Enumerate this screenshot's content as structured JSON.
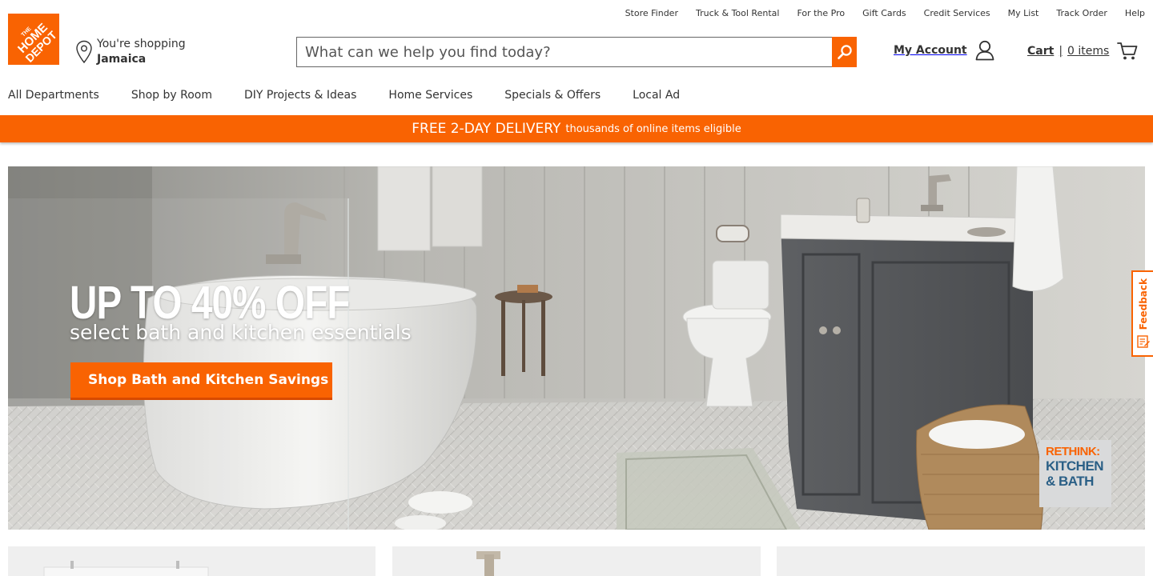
{
  "utility_nav": [
    {
      "label": "Store Finder"
    },
    {
      "label": "Truck & Tool Rental"
    },
    {
      "label": "For the Pro"
    },
    {
      "label": "Gift Cards"
    },
    {
      "label": "Credit Services"
    },
    {
      "label": "My List"
    },
    {
      "label": "Track Order"
    },
    {
      "label": "Help"
    }
  ],
  "brand": {
    "logo_text": "THE HOME DEPOT",
    "color": "#f96302"
  },
  "store": {
    "prefix": "You're shopping",
    "name": "Jamaica",
    "icon": "location-pin-icon"
  },
  "search": {
    "placeholder": "What can we help you find today?",
    "value": "",
    "icon": "search-icon"
  },
  "account": {
    "label": "My Account",
    "icon": "user-icon"
  },
  "cart": {
    "label": "Cart",
    "separator": "|",
    "count_text": "0 items",
    "icon": "cart-icon"
  },
  "main_nav": [
    {
      "label": "All Departments"
    },
    {
      "label": "Shop by Room"
    },
    {
      "label": "DIY Projects & Ideas"
    },
    {
      "label": "Home Services"
    },
    {
      "label": "Specials & Offers"
    },
    {
      "label": "Local Ad"
    }
  ],
  "promo": {
    "headline": "FREE 2-DAY DELIVERY",
    "detail": "thousands of online items eligible"
  },
  "hero": {
    "headline": "UP TO 40% OFF",
    "subheadline": "select bath and kitchen essentials",
    "cta_label": "Shop Bath and Kitchen Savings",
    "badge_line1": "RETHINK:",
    "badge_line2": "KITCHEN",
    "badge_line3": "& BATH"
  },
  "feedback": {
    "label": "Feedback",
    "icon": "feedback-icon"
  },
  "colors": {
    "accent": "#f96302",
    "badge_blue": "#2a5f86"
  }
}
